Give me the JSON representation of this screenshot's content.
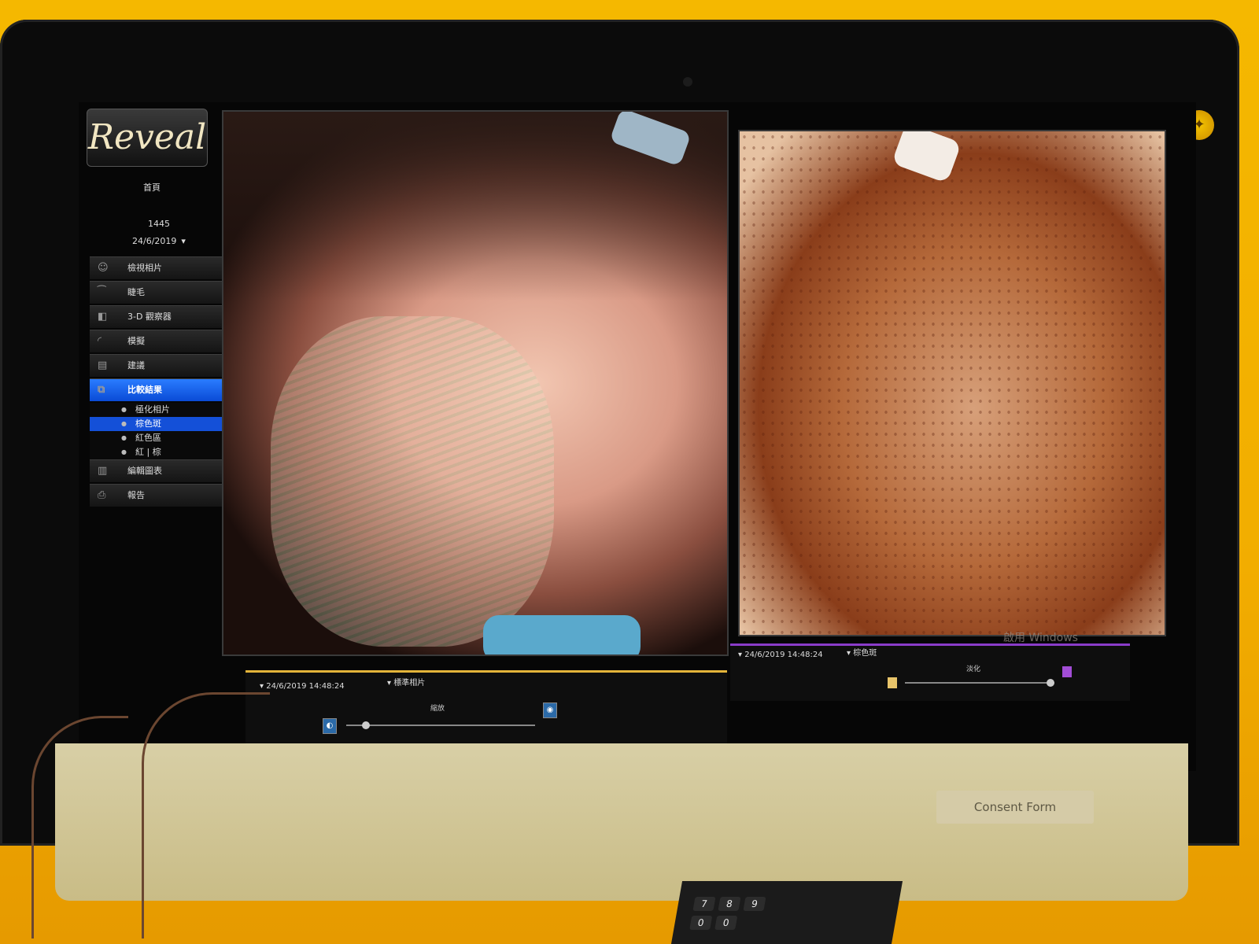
{
  "app": {
    "logo_text": "Reveal",
    "home_label": "首頁",
    "patient_id": "1445",
    "date": "24/6/2019"
  },
  "sidebar": {
    "items": [
      {
        "label": "檢視相片",
        "icon": "face-icon"
      },
      {
        "label": "睫毛",
        "icon": "eyelash-icon"
      },
      {
        "label": "3-D 觀察器",
        "icon": "3d-viewer-icon"
      },
      {
        "label": "模擬",
        "icon": "simulation-icon"
      },
      {
        "label": "建議",
        "icon": "recommendation-icon"
      },
      {
        "label": "比較結果",
        "icon": "compare-icon",
        "active": true
      }
    ],
    "sub_items": [
      {
        "label": "極化相片"
      },
      {
        "label": "棕色斑",
        "active": true
      },
      {
        "label": "紅色區"
      },
      {
        "label": "紅 | 棕"
      }
    ],
    "bottom_items": [
      {
        "label": "編輯圖表",
        "icon": "chart-icon"
      },
      {
        "label": "報告",
        "icon": "print-icon"
      }
    ]
  },
  "left_panel": {
    "timestamp": "24/6/2019 14:48:24",
    "view": "標準相片",
    "slider_label": "縮放",
    "accent": "#e3b43a"
  },
  "right_panel": {
    "timestamp": "24/6/2019 14:48:24",
    "view": "棕色斑",
    "slider_label": "淡化",
    "accent": "#8a3cc9",
    "watermark": "啟用 Windows"
  },
  "desk": {
    "consent_label": "Consent Form",
    "calculator_keys": [
      "7",
      "8",
      "9",
      "0",
      "0"
    ]
  },
  "colors": {
    "background": "#f5b800",
    "sidebar_active": "#1450d8"
  }
}
